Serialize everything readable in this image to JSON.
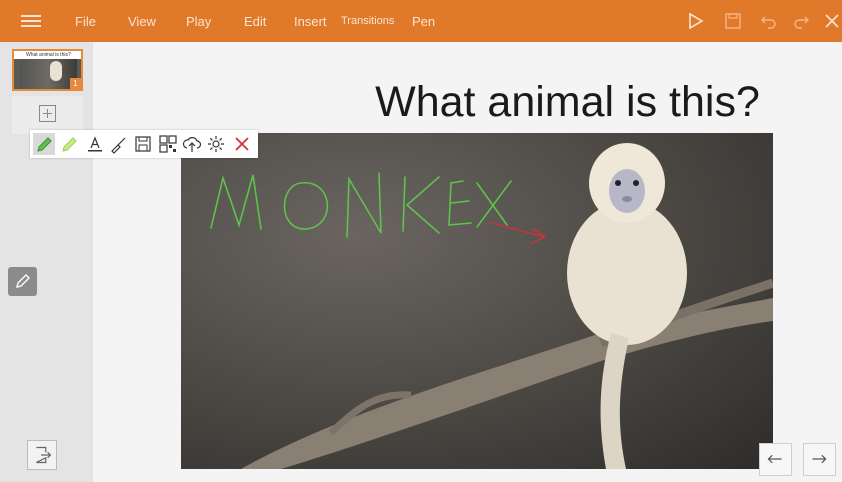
{
  "menu": {
    "items": [
      "File",
      "View",
      "Play",
      "Edit",
      "Insert",
      "Transitions",
      "Pen"
    ]
  },
  "toolbar_right": {
    "icons": [
      "play-icon",
      "save-icon",
      "undo-icon",
      "redo-icon",
      "close-icon"
    ]
  },
  "slides": [
    {
      "thumb_title": "What animal is this?",
      "number": "1"
    }
  ],
  "slide": {
    "title": "What animal is this?",
    "handwriting": "MONKEY",
    "ink_colors": {
      "green": "#5fc24a",
      "red": "#d3303a"
    }
  },
  "pen_toolbar": {
    "tools": [
      "pen-icon",
      "highlighter-icon",
      "text-color-icon",
      "eraser-icon",
      "save-icon",
      "qr-code-icon",
      "cloud-upload-icon",
      "settings-icon",
      "close-icon"
    ]
  },
  "colors": {
    "accent": "#e07a2a",
    "highlight": "#e58a3d"
  }
}
